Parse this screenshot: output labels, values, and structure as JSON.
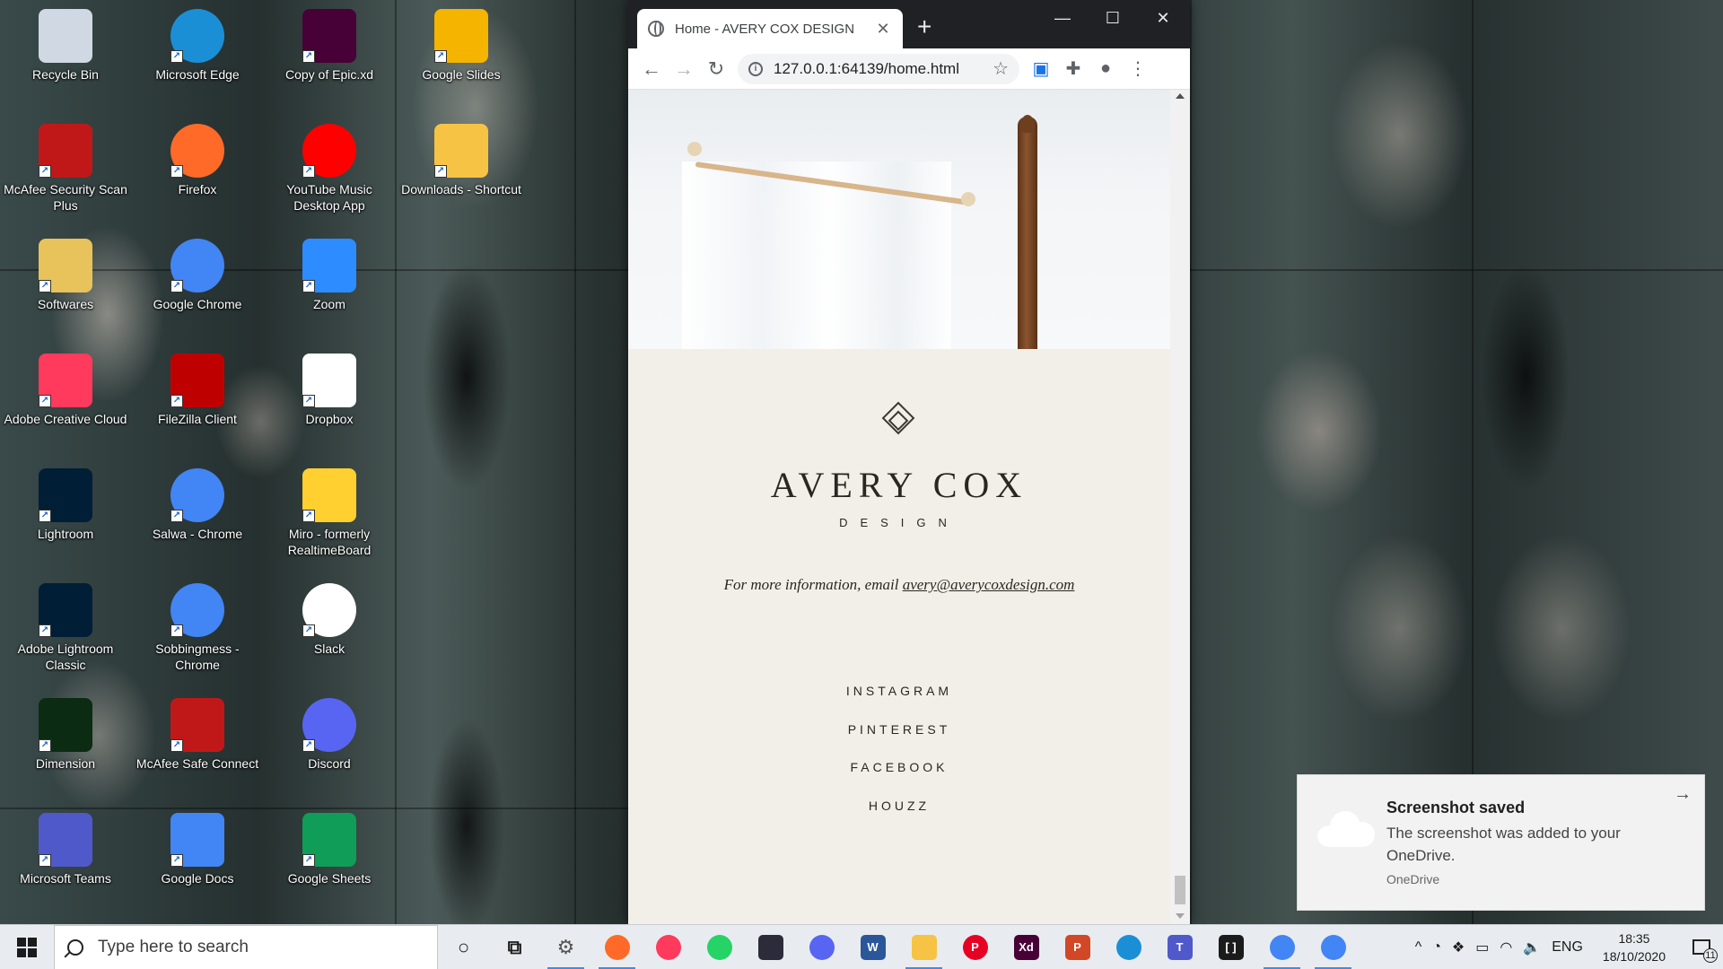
{
  "desktop": {
    "icons": [
      {
        "label": "Recycle Bin",
        "icon": "recycle-bin-icon",
        "color": "#cfd8e3"
      },
      {
        "label": "Microsoft Edge",
        "icon": "edge-icon",
        "color": "#1b8fd6"
      },
      {
        "label": "Copy of Epic.xd",
        "icon": "xd-file-icon",
        "color": "#470137"
      },
      {
        "label": "Google Slides",
        "icon": "google-slides-icon",
        "color": "#f4b400"
      },
      {
        "label": "McAfee Security Scan Plus",
        "icon": "mcafee-icon",
        "color": "#c01818"
      },
      {
        "label": "Firefox",
        "icon": "firefox-icon",
        "color": "#ff6a28"
      },
      {
        "label": "YouTube Music Desktop App",
        "icon": "youtube-music-icon",
        "color": "#ff0000"
      },
      {
        "label": "Downloads - Shortcut",
        "icon": "downloads-folder-icon",
        "color": "#f6c344"
      },
      {
        "label": "Softwares",
        "icon": "folder-icon",
        "color": "#e8c25a"
      },
      {
        "label": "Google Chrome",
        "icon": "chrome-icon",
        "color": "#4285f4"
      },
      {
        "label": "Zoom",
        "icon": "zoom-icon",
        "color": "#2d8cff"
      },
      {
        "label": "Adobe Creative Cloud",
        "icon": "creative-cloud-icon",
        "color": "#ff3a5c"
      },
      {
        "label": "FileZilla Client",
        "icon": "filezilla-icon",
        "color": "#bf0000"
      },
      {
        "label": "Dropbox",
        "icon": "dropbox-icon",
        "color": "#ffffff"
      },
      {
        "label": "Lightroom",
        "icon": "lightroom-icon",
        "color": "#001e36"
      },
      {
        "label": "Salwa - Chrome",
        "icon": "chrome-profile-icon",
        "color": "#4285f4"
      },
      {
        "label": "Miro - formerly RealtimeBoard",
        "icon": "miro-icon",
        "color": "#ffd02f"
      },
      {
        "label": "Adobe Lightroom Classic",
        "icon": "lightroom-classic-icon",
        "color": "#001e36"
      },
      {
        "label": "Sobbingmess - Chrome",
        "icon": "chrome-profile-icon",
        "color": "#4285f4"
      },
      {
        "label": "Slack",
        "icon": "slack-icon",
        "color": "#ffffff"
      },
      {
        "label": "Dimension",
        "icon": "dimension-icon",
        "color": "#0c2b13"
      },
      {
        "label": "McAfee Safe Connect",
        "icon": "mcafee-safe-connect-icon",
        "color": "#c01818"
      },
      {
        "label": "Discord",
        "icon": "discord-icon",
        "color": "#5865f2"
      },
      {
        "label": "Microsoft Teams",
        "icon": "teams-icon",
        "color": "#5059c9"
      },
      {
        "label": "Google Docs",
        "icon": "google-docs-icon",
        "color": "#4285f4"
      },
      {
        "label": "Google Sheets",
        "icon": "google-sheets-icon",
        "color": "#0f9d58"
      }
    ]
  },
  "browser": {
    "tab_title": "Home - AVERY COX DESIGN",
    "url": "127.0.0.1:64139/home.html"
  },
  "page": {
    "brand_name": "AVERY COX",
    "brand_sub": "DESIGN",
    "info_prefix": "For more information, email ",
    "info_email": "avery@averycoxdesign.com",
    "social": [
      "INSTAGRAM",
      "PINTEREST",
      "FACEBOOK",
      "HOUZZ"
    ],
    "footer_bg": "#f2efe8"
  },
  "toast": {
    "title": "Screenshot saved",
    "body": "The screenshot was added to your OneDrive.",
    "source": "OneDrive"
  },
  "taskbar": {
    "search_placeholder": "Type here to search",
    "apps": [
      {
        "name": "cortana",
        "icon": "cortana-icon",
        "color": "#1b1b1b",
        "glyph": "○",
        "active": false
      },
      {
        "name": "task-view",
        "icon": "task-view-icon",
        "color": "#1b1b1b",
        "glyph": "⧉",
        "active": false
      },
      {
        "name": "settings",
        "icon": "gear-icon",
        "color": "#555555",
        "glyph": "⚙",
        "active": true
      },
      {
        "name": "firefox",
        "icon": "firefox-icon",
        "color": "#ff6a28",
        "glyph": "",
        "active": true
      },
      {
        "name": "creative-cloud",
        "icon": "creative-cloud-icon",
        "color": "#ff3a5c",
        "glyph": "",
        "active": false
      },
      {
        "name": "whatsapp",
        "icon": "whatsapp-icon",
        "color": "#25d366",
        "glyph": "",
        "active": false
      },
      {
        "name": "pen-app",
        "icon": "pen-icon",
        "color": "#2b2b3a",
        "glyph": "",
        "active": false
      },
      {
        "name": "discord",
        "icon": "discord-icon",
        "color": "#5865f2",
        "glyph": "",
        "active": false
      },
      {
        "name": "word",
        "icon": "word-icon",
        "color": "#2b579a",
        "glyph": "W",
        "active": false
      },
      {
        "name": "file-explorer",
        "icon": "folder-icon",
        "color": "#f6c344",
        "glyph": "",
        "active": true
      },
      {
        "name": "pinterest",
        "icon": "pinterest-icon",
        "color": "#e60023",
        "glyph": "P",
        "active": false
      },
      {
        "name": "xd",
        "icon": "xd-icon",
        "color": "#470137",
        "glyph": "Xd",
        "active": false
      },
      {
        "name": "powerpoint",
        "icon": "powerpoint-icon",
        "color": "#d24726",
        "glyph": "P",
        "active": false
      },
      {
        "name": "edge",
        "icon": "edge-icon",
        "color": "#1b8fd6",
        "glyph": "",
        "active": false
      },
      {
        "name": "teams",
        "icon": "teams-icon",
        "color": "#5059c9",
        "glyph": "T",
        "active": false
      },
      {
        "name": "brackets",
        "icon": "brackets-icon",
        "color": "#1b1b1b",
        "glyph": "[ ]",
        "active": false
      },
      {
        "name": "chrome-profile",
        "icon": "chrome-profile-icon",
        "color": "#4285f4",
        "glyph": "",
        "active": true
      },
      {
        "name": "chrome",
        "icon": "chrome-icon",
        "color": "#4285f4",
        "glyph": "",
        "active": true
      }
    ],
    "language": "ENG",
    "time": "18:35",
    "date": "18/10/2020",
    "notification_count": "11"
  }
}
